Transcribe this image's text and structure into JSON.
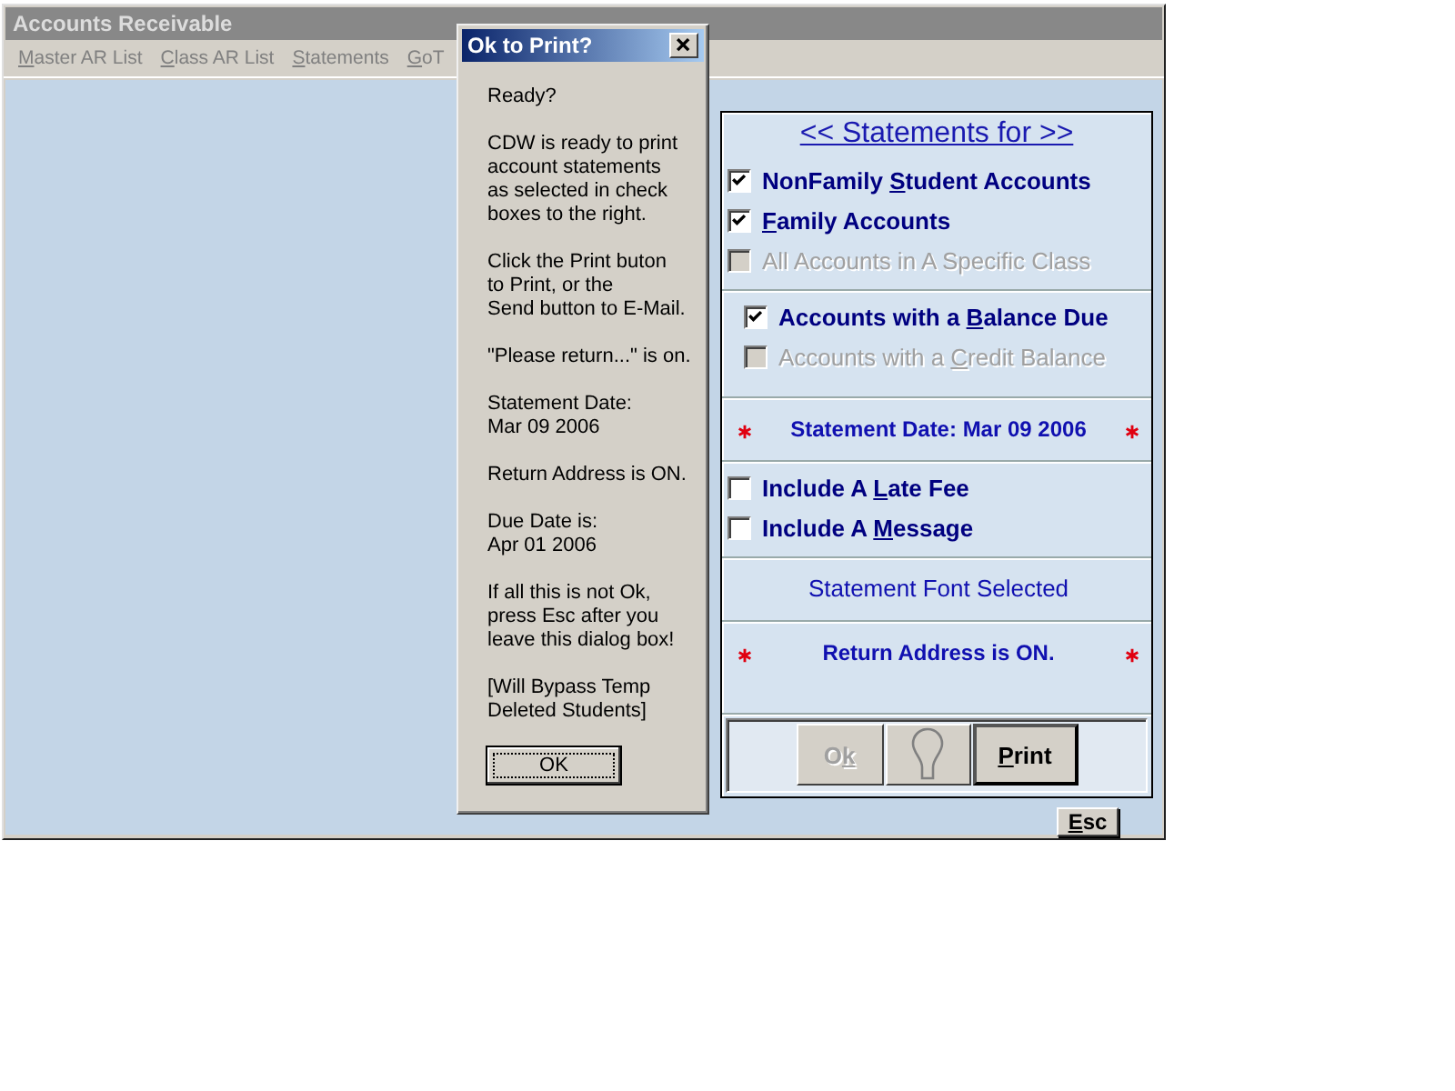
{
  "window": {
    "title": "Accounts Receivable"
  },
  "menu": [
    {
      "label_parts": {
        "key": "M",
        "after": "aster AR List"
      }
    },
    {
      "label_parts": {
        "key": "C",
        "after": "lass AR List"
      }
    },
    {
      "label_parts": {
        "key": "S",
        "after": "tatements"
      }
    },
    {
      "label_parts": {
        "key": "G",
        "after": "oT"
      }
    }
  ],
  "dialog": {
    "title": "Ok to Print?",
    "paragraphs": [
      "Ready?",
      "CDW is ready to print\naccount statements\nas selected in check\nboxes to the right.",
      "Click the Print buton\nto Print, or the\nSend button to E-Mail.",
      "\"Please return...\" is on.",
      "Statement Date:\nMar 09 2006",
      "Return Address is ON.",
      "Due Date is:\nApr 01 2006",
      "If all this is not Ok,\npress Esc after you\nleave this dialog box!",
      "[Will Bypass Temp\nDeleted Students]"
    ],
    "ok_button": "OK"
  },
  "panel": {
    "heading": "<< Statements for >>",
    "sections": [
      {
        "rows": [
          {
            "kind": "check",
            "label_parts": {
              "before": "NonFamily ",
              "key": "S",
              "after": "tudent Accounts"
            },
            "checked": true,
            "disabled": false
          },
          {
            "kind": "check",
            "label_parts": {
              "key": "F",
              "after": "amily Accounts"
            },
            "checked": true,
            "disabled": false
          },
          {
            "kind": "check",
            "label_parts": {
              "before": "All Accounts in A Specific Class"
            },
            "checked": false,
            "disabled": true
          }
        ]
      },
      {
        "rows": [
          {
            "kind": "check",
            "label_parts": {
              "before": "Accounts with a ",
              "key": "B",
              "after": "alance Due"
            },
            "checked": true,
            "disabled": false
          },
          {
            "kind": "check",
            "label_parts": {
              "before": "Accounts with a ",
              "key": "C",
              "after": "redit Balance"
            },
            "checked": false,
            "disabled": true
          }
        ]
      },
      {
        "rows": [
          {
            "kind": "note",
            "text": "Statement Date: Mar 09 2006",
            "bold": true,
            "starred": true
          }
        ]
      },
      {
        "rows": [
          {
            "kind": "check",
            "label_parts": {
              "before": "Include A ",
              "key": "L",
              "after": "ate Fee"
            },
            "checked": false,
            "disabled": false
          },
          {
            "kind": "check",
            "label_parts": {
              "before": "Include A ",
              "key": "M",
              "after": "essage"
            },
            "checked": false,
            "disabled": false
          }
        ]
      },
      {
        "rows": [
          {
            "kind": "note",
            "text": "Statement Font Selected",
            "bold": false,
            "starred": false
          }
        ]
      },
      {
        "rows": [
          {
            "kind": "note",
            "text": "Return Address is ON.",
            "bold": true,
            "starred": true
          }
        ]
      }
    ],
    "buttons": [
      {
        "kind": "text",
        "label_parts": {
          "before": "O",
          "key": "k"
        },
        "disabled": true
      },
      {
        "kind": "bulb",
        "disabled": false
      },
      {
        "kind": "text",
        "label_parts": {
          "key": "P",
          "after": "rint"
        },
        "disabled": false
      }
    ]
  },
  "esc_button": {
    "label_parts": {
      "key": "E",
      "after": "sc"
    }
  }
}
